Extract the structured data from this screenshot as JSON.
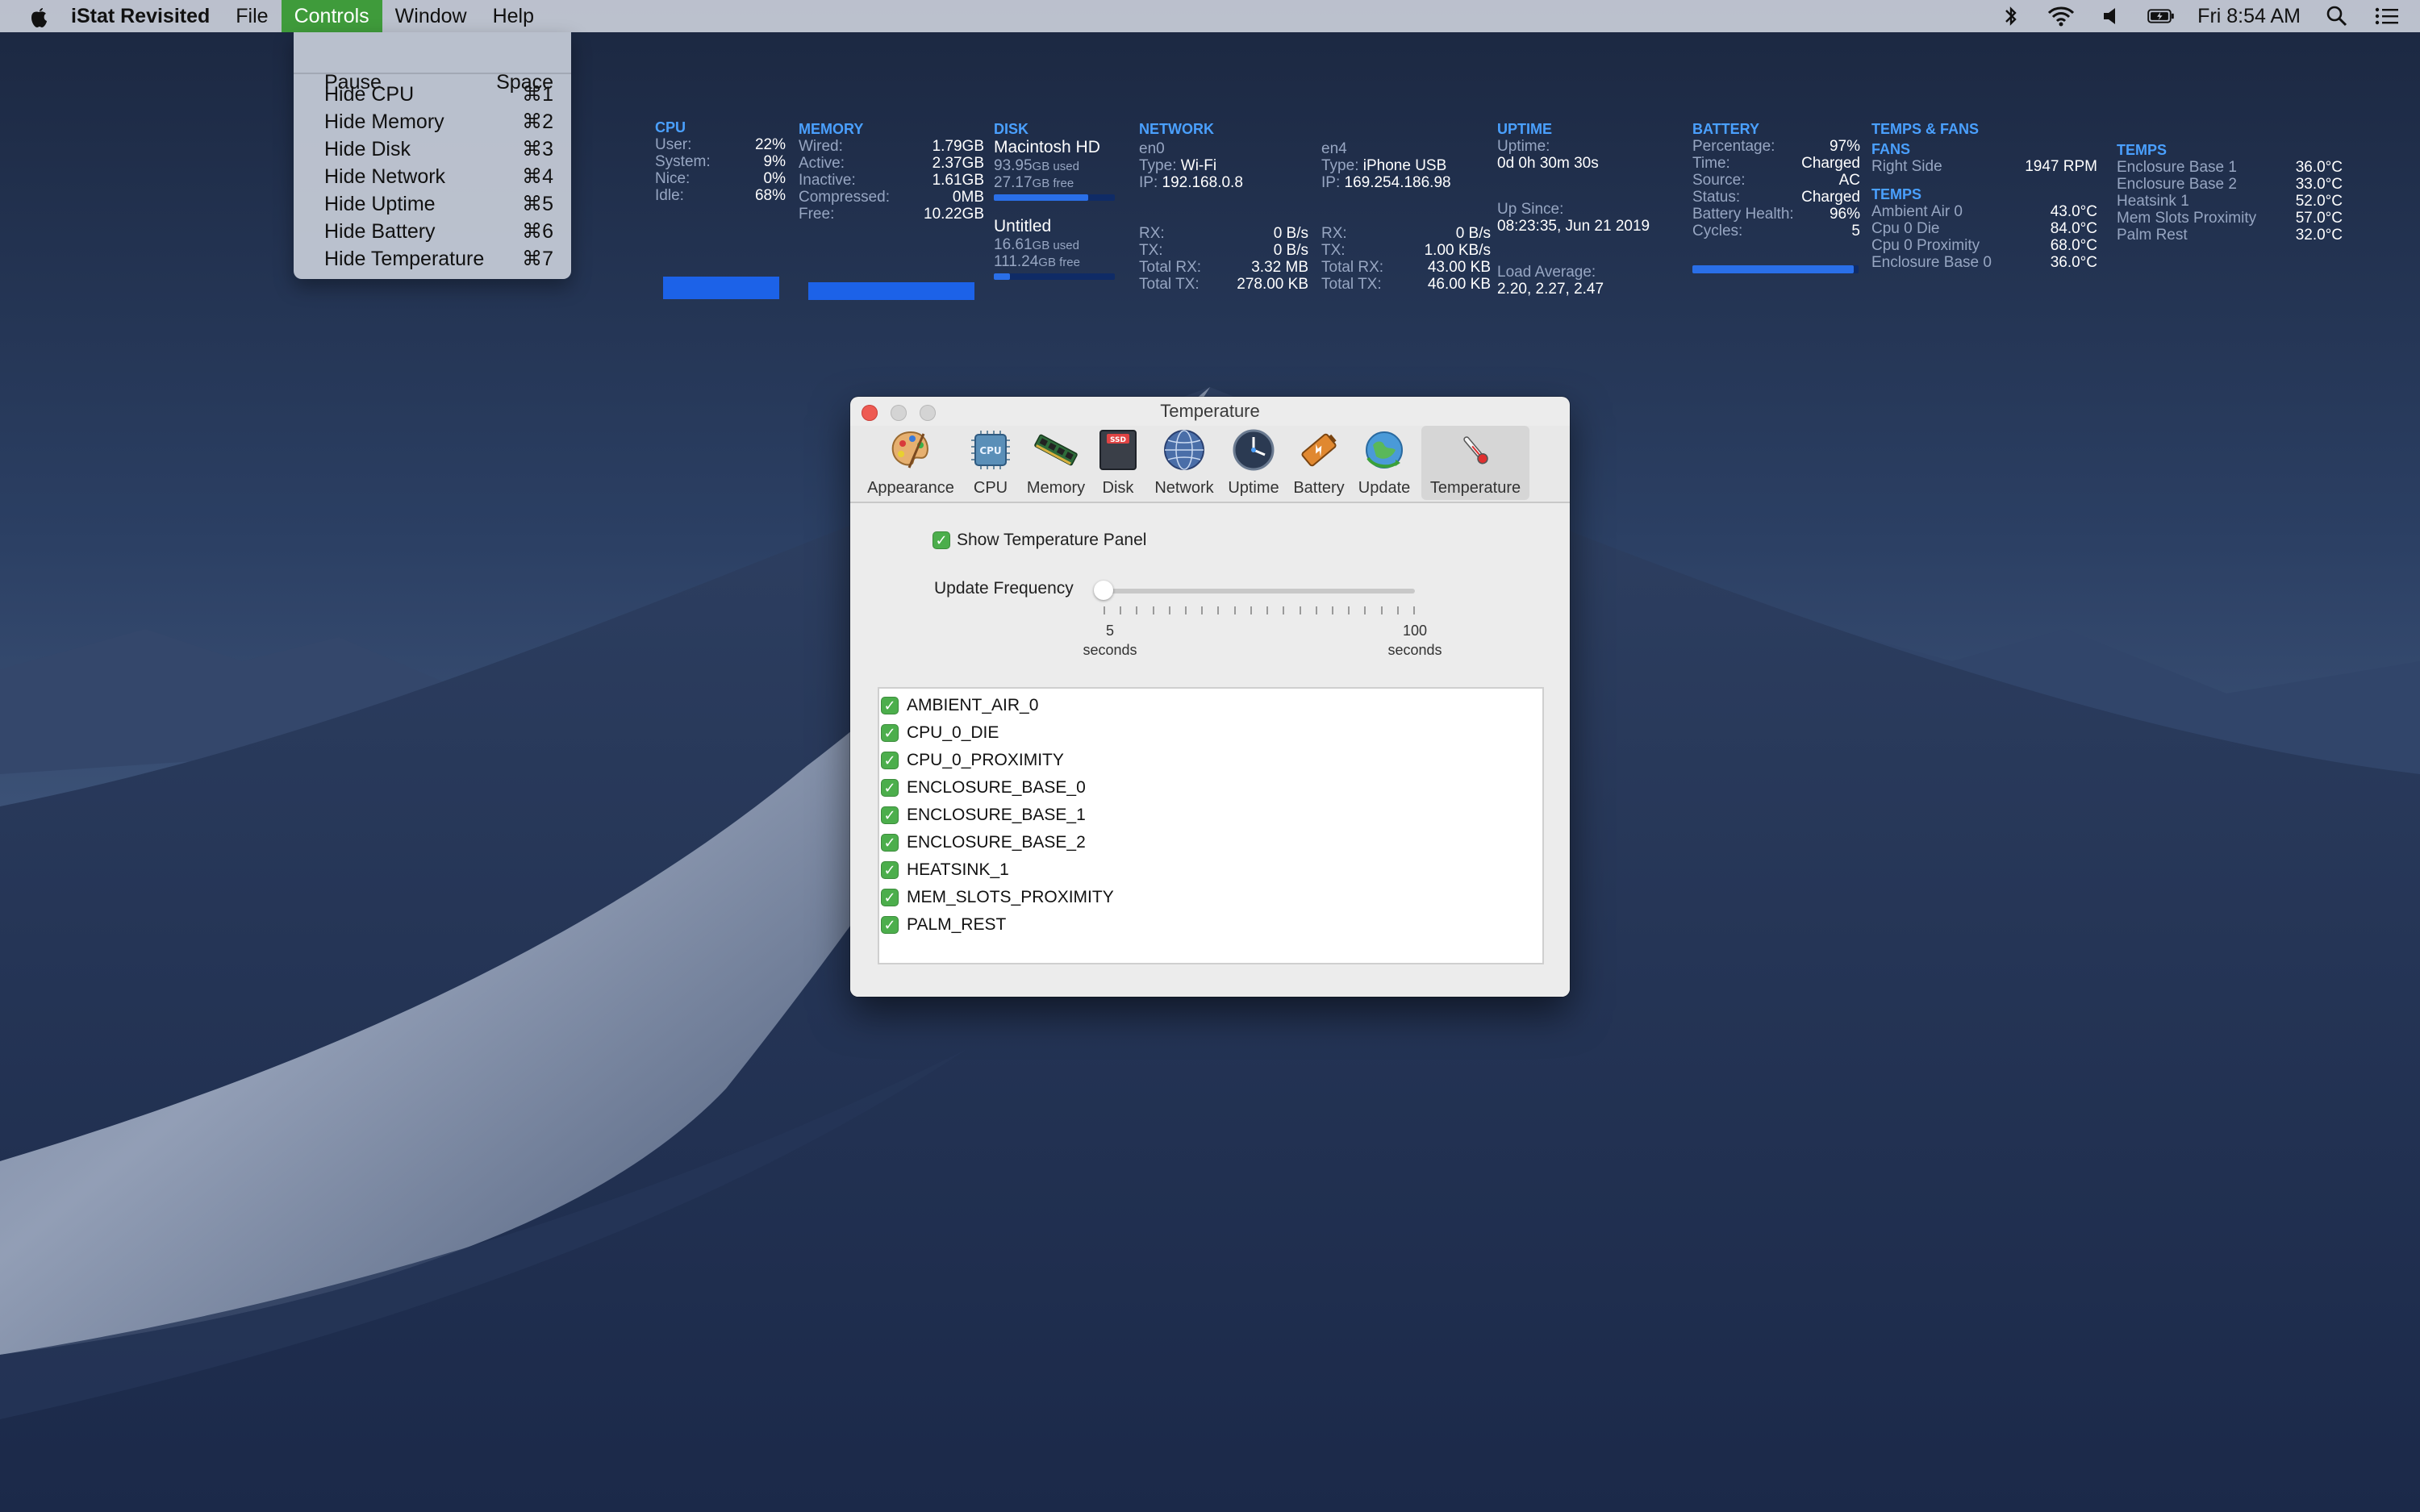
{
  "menubar": {
    "app_name": "iStat Revisited",
    "menus": [
      "File",
      "Controls",
      "Window",
      "Help"
    ],
    "active_menu": "Controls",
    "clock": "Fri 8:54 AM"
  },
  "controls_menu": {
    "items": [
      {
        "label": "Pause",
        "shortcut": "Space"
      },
      {
        "label": "Hide CPU",
        "shortcut": "⌘1"
      },
      {
        "label": "Hide Memory",
        "shortcut": "⌘2"
      },
      {
        "label": "Hide Disk",
        "shortcut": "⌘3"
      },
      {
        "label": "Hide Network",
        "shortcut": "⌘4"
      },
      {
        "label": "Hide Uptime",
        "shortcut": "⌘5"
      },
      {
        "label": "Hide Battery",
        "shortcut": "⌘6"
      },
      {
        "label": "Hide Temperature",
        "shortcut": "⌘7"
      }
    ]
  },
  "stats": {
    "cpu": {
      "title": "CPU",
      "rows": [
        {
          "label": "User:",
          "value": "22%"
        },
        {
          "label": "System:",
          "value": "9%"
        },
        {
          "label": "Nice:",
          "value": "0%"
        },
        {
          "label": "Idle:",
          "value": "68%"
        }
      ]
    },
    "memory": {
      "title": "MEMORY",
      "rows": [
        {
          "label": "Wired:",
          "value": "1.79GB"
        },
        {
          "label": "Active:",
          "value": "2.37GB"
        },
        {
          "label": "Inactive:",
          "value": "1.61GB"
        },
        {
          "label": "Compressed:",
          "value": "0MB"
        },
        {
          "label": "Free:",
          "value": "10.22GB"
        }
      ]
    },
    "disk": {
      "title": "DISK",
      "volumes": [
        {
          "name": "Macintosh HD",
          "used_value": "93.95",
          "used_unit": "GB used",
          "free_value": "27.17",
          "free_unit": "GB free",
          "fill": 0.78
        },
        {
          "name": "Untitled",
          "used_value": "16.61",
          "used_unit": "GB used",
          "free_value": "111.24",
          "free_unit": "GB free",
          "fill": 0.13
        }
      ]
    },
    "network": {
      "title": "NETWORK",
      "interfaces": [
        {
          "name": "en0",
          "type_label": "Type:",
          "type": "Wi-Fi",
          "ip_label": "IP:",
          "ip": "192.168.0.8",
          "rx_label": "RX:",
          "rx": "0 B/s",
          "tx_label": "TX:",
          "tx": "0 B/s",
          "total_rx_label": "Total RX:",
          "total_rx": "3.32 MB",
          "total_tx_label": "Total TX:",
          "total_tx": "278.00 KB"
        },
        {
          "name": "en4",
          "type_label": "Type:",
          "type": "iPhone USB",
          "ip_label": "IP:",
          "ip": "169.254.186.98",
          "rx_label": "RX:",
          "rx": "0 B/s",
          "tx_label": "TX:",
          "tx": "1.00 KB/s",
          "total_rx_label": "Total RX:",
          "total_rx": "43.00 KB",
          "total_tx_label": "Total TX:",
          "total_tx": "46.00 KB"
        }
      ]
    },
    "uptime": {
      "title": "UPTIME",
      "uptime_label": "Uptime:",
      "uptime": "0d 0h 30m 30s",
      "since_label": "Up Since:",
      "since": "08:23:35, Jun 21 2019",
      "load_label": "Load Average:",
      "load": "2.20, 2.27, 2.47"
    },
    "battery": {
      "title": "BATTERY",
      "rows": [
        {
          "label": "Percentage:",
          "value": "97%"
        },
        {
          "label": "Time:",
          "value": "Charged"
        },
        {
          "label": "Source:",
          "value": "AC"
        },
        {
          "label": "Status:",
          "value": "Charged"
        },
        {
          "label": "Battery Health:",
          "value": "96%"
        },
        {
          "label": "Cycles:",
          "value": "5"
        }
      ],
      "level": 0.97
    },
    "temps_fans": {
      "title": "TEMPS & FANS",
      "fans_title": "FANS",
      "fans": [
        {
          "label": "Right Side",
          "value": "1947 RPM"
        }
      ],
      "temps_title": "TEMPS",
      "temps": [
        {
          "label": "Ambient Air 0",
          "value": "43.0°C"
        },
        {
          "label": "Cpu 0 Die",
          "value": "84.0°C"
        },
        {
          "label": "Cpu 0 Proximity",
          "value": "68.0°C"
        },
        {
          "label": "Enclosure Base 0",
          "value": "36.0°C"
        }
      ]
    },
    "temps2": {
      "title": "TEMPS",
      "temps": [
        {
          "label": "Enclosure Base 1",
          "value": "36.0°C"
        },
        {
          "label": "Enclosure Base 2",
          "value": "33.0°C"
        },
        {
          "label": "Heatsink 1",
          "value": "52.0°C"
        },
        {
          "label": "Mem Slots Proximity",
          "value": "57.0°C"
        },
        {
          "label": "Palm Rest",
          "value": "32.0°C"
        }
      ]
    }
  },
  "window": {
    "title": "Temperature",
    "toolbar": [
      {
        "label": "Appearance",
        "icon": "palette-icon"
      },
      {
        "label": "CPU",
        "icon": "cpu-chip-icon"
      },
      {
        "label": "Memory",
        "icon": "memory-module-icon"
      },
      {
        "label": "Disk",
        "icon": "ssd-icon"
      },
      {
        "label": "Network",
        "icon": "globe-icon"
      },
      {
        "label": "Uptime",
        "icon": "clock-icon"
      },
      {
        "label": "Battery",
        "icon": "battery-icon"
      },
      {
        "label": "Update",
        "icon": "update-globe-icon"
      },
      {
        "label": "Temperature",
        "icon": "thermometer-icon"
      }
    ],
    "selected_tab": "Temperature",
    "show_panel_label": "Show Temperature Panel",
    "show_panel_checked": true,
    "update_frequency_label": "Update Frequency",
    "slider": {
      "min_value": "5",
      "min_unit": "seconds",
      "max_value": "100",
      "max_unit": "seconds",
      "value": 5
    },
    "sensors": [
      {
        "name": "AMBIENT_AIR_0",
        "checked": true
      },
      {
        "name": "CPU_0_DIE",
        "checked": true
      },
      {
        "name": "CPU_0_PROXIMITY",
        "checked": true
      },
      {
        "name": "ENCLOSURE_BASE_0",
        "checked": true
      },
      {
        "name": "ENCLOSURE_BASE_1",
        "checked": true
      },
      {
        "name": "ENCLOSURE_BASE_2",
        "checked": true
      },
      {
        "name": "HEATSINK_1",
        "checked": true
      },
      {
        "name": "MEM_SLOTS_PROXIMITY",
        "checked": true
      },
      {
        "name": "PALM_REST",
        "checked": true
      }
    ]
  },
  "colors": {
    "menu_active": "#3f9b3b",
    "stat_heading": "#4aa0ff",
    "bar_fill": "#2a6fe8",
    "checkbox": "#4cae4c",
    "close_button": "#ee5a52"
  }
}
